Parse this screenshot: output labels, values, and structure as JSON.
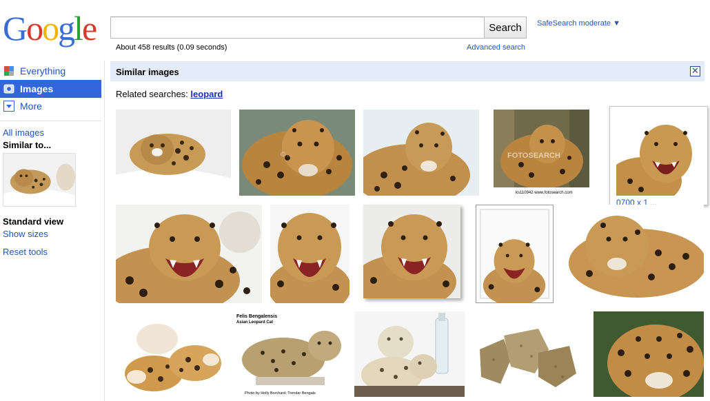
{
  "logo": {
    "text": [
      "G",
      "o",
      "o",
      "g",
      "l",
      "e"
    ],
    "colors": [
      "#3b6cd6",
      "#d53a2b",
      "#f2b301",
      "#3b6cd6",
      "#20a13a",
      "#d53a2b"
    ]
  },
  "search": {
    "value": "",
    "button_label": "Search"
  },
  "safesearch": {
    "label": "SafeSearch moderate ▼"
  },
  "results": {
    "stats": "About 458 results (0.09 seconds)",
    "advanced_label": "Advanced search"
  },
  "sidebar": {
    "nav": [
      {
        "label": "Everything",
        "icon": "everything-icon"
      },
      {
        "label": "Images",
        "icon": "camera-icon"
      },
      {
        "label": "More",
        "icon": "dropdown-arrow-icon"
      }
    ],
    "all_images": "All images",
    "similar_to": "Similar to...",
    "standard_view": "Standard view",
    "show_sizes": "Show sizes",
    "reset_tools": "Reset tools"
  },
  "similar": {
    "title": "Similar images",
    "close": "✕"
  },
  "related": {
    "prefix": "Related searches:",
    "link": "leopard"
  },
  "thumbnails": {
    "watermark_2": "© ...",
    "watermark_4": "FOTOSEARCH",
    "caption_4": "ks110942 www.fotosearch.com",
    "title_12": "Felis Bengalensis",
    "subtitle_12": "Asian Leopard Cat",
    "credit_12": "Photo by Holly Borchard, Trendar Bengals",
    "hover_caption": "0700 x 1 ..."
  },
  "colors": {
    "accent": "#3366dd",
    "link": "#2255b8",
    "bar_bg": "#e5ecf9"
  }
}
